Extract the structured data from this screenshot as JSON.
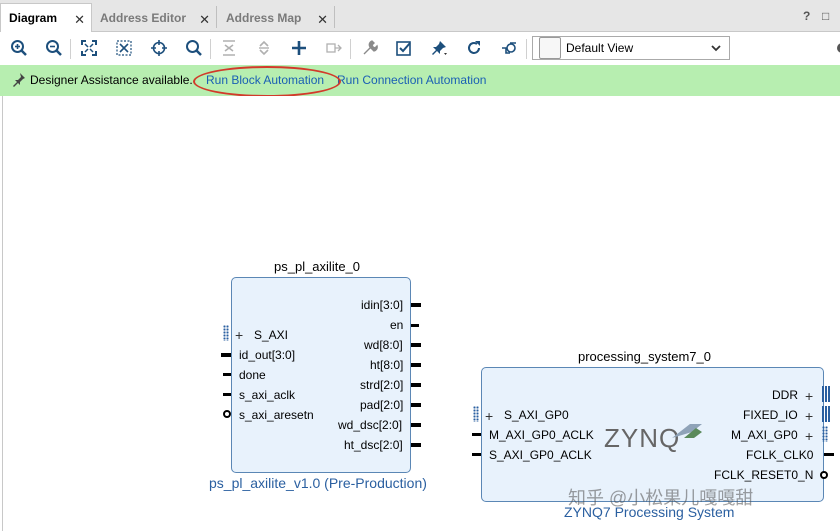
{
  "tabs": [
    {
      "label": "Diagram",
      "active": true
    },
    {
      "label": "Address Editor",
      "active": false
    },
    {
      "label": "Address Map",
      "active": false
    }
  ],
  "tab_right": {
    "help": "?",
    "restore": "□"
  },
  "toolbar": {
    "icons": [
      "zoom-in-icon",
      "zoom-out-icon",
      "fit-view-icon",
      "fit-selection-icon",
      "auto-connect-icon",
      "search-icon",
      "collapse-icon",
      "expand-icon",
      "add-ip-icon",
      "make-external-icon",
      "properties-icon",
      "validate-icon",
      "pin-icon",
      "regenerate-icon",
      "optimize-routing-icon"
    ],
    "view_select": "Default View"
  },
  "assist": {
    "message": "Designer Assistance available.",
    "link_block": "Run Block Automation",
    "link_connection": "Run Connection Automation",
    "bg_color": "#b7eeb0",
    "link_color": "#1a5fb4"
  },
  "blocks": {
    "axilite": {
      "title": "ps_pl_axilite_0",
      "subtitle": "ps_pl_axilite_v1.0 (Pre-Production)",
      "inputs": [
        "S_AXI",
        "id_out[3:0]",
        "done",
        "s_axi_aclk",
        "s_axi_aresetn"
      ],
      "outputs": [
        "idin[3:0]",
        "en",
        "wd[8:0]",
        "ht[8:0]",
        "strd[2:0]",
        "pad[2:0]",
        "wd_dsc[2:0]",
        "ht_dsc[2:0]"
      ]
    },
    "ps7": {
      "title": "processing_system7_0",
      "subtitle": "ZYNQ7 Processing System",
      "logo": "ZYNQ",
      "inputs": [
        "S_AXI_GP0",
        "M_AXI_GP0_ACLK",
        "S_AXI_GP0_ACLK"
      ],
      "outputs": [
        "DDR",
        "FIXED_IO",
        "M_AXI_GP0",
        "FCLK_CLK0",
        "FCLK_RESET0_N"
      ]
    }
  },
  "watermark": "知乎 @小松果儿嘎嘎甜"
}
